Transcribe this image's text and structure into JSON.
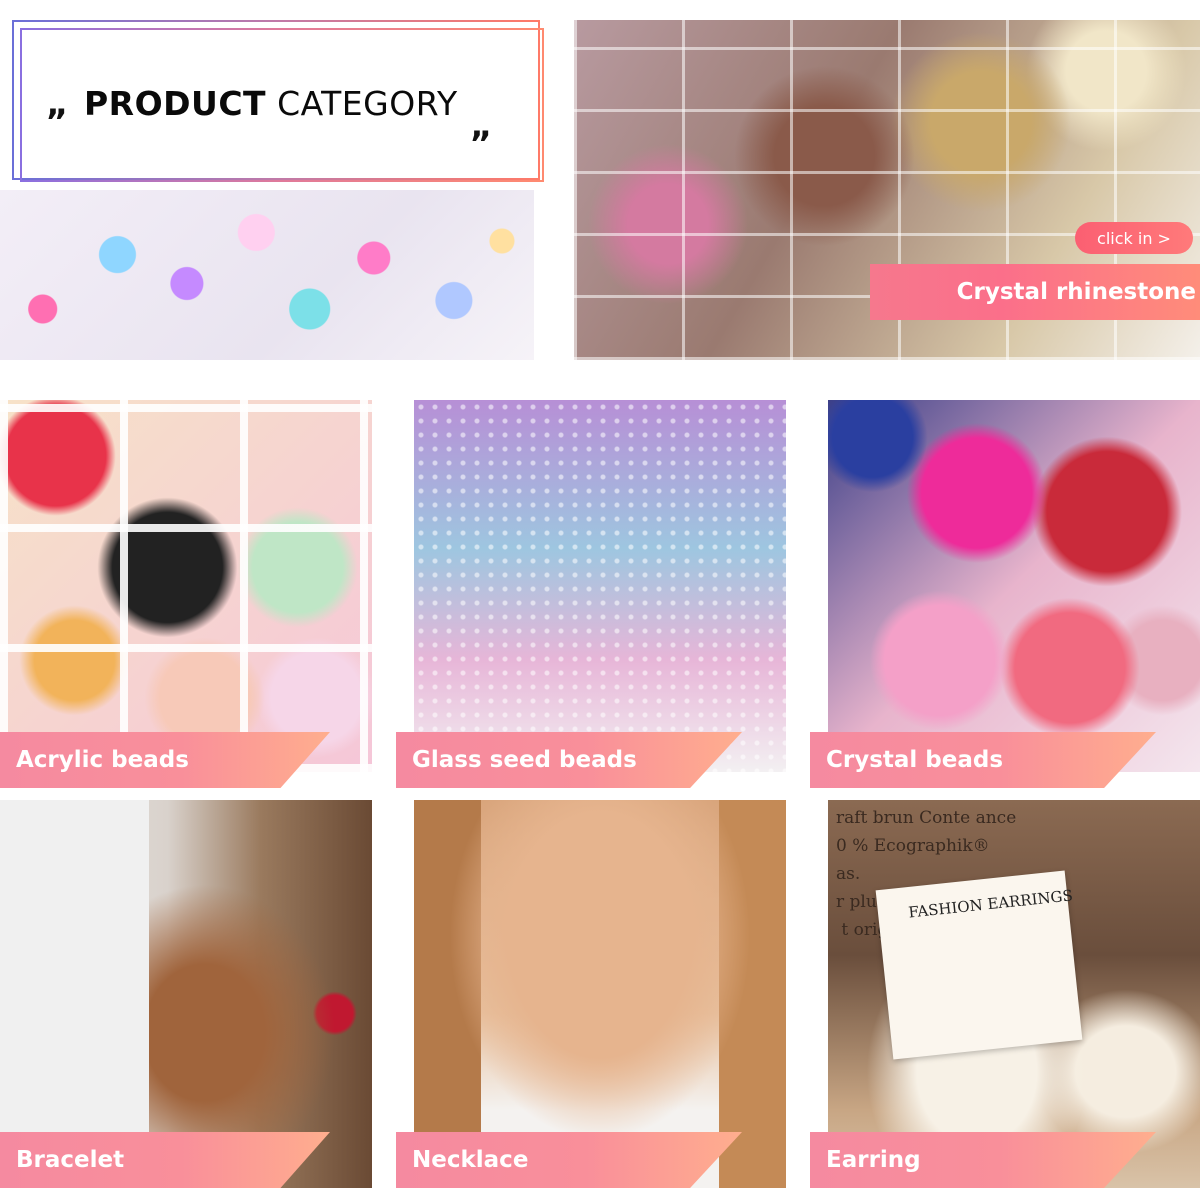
{
  "header": {
    "open_quote": "„",
    "title_bold": "PRODUCT",
    "title_light": "CATEGORY",
    "close_quote": "„"
  },
  "featured": {
    "category": "Crystal rhinestone",
    "button_label": "click in >"
  },
  "categories": [
    {
      "label": "Acrylic beads"
    },
    {
      "label": "Glass seed beads"
    },
    {
      "label": "Crystal beads"
    },
    {
      "label": "Bracelet"
    },
    {
      "label": "Necklace"
    },
    {
      "label": "Earring"
    }
  ],
  "earring_photo": {
    "card_text": "FASHION EARRINGS",
    "paper_text": "raft brun Conte ance\n0 % Ecographik®\nas.\nr plusieurs fois.\n t original"
  },
  "colors": {
    "label_gradient_start": "#f58aa0",
    "label_gradient_end": "#ffae8e",
    "button": "#fb5f72"
  }
}
